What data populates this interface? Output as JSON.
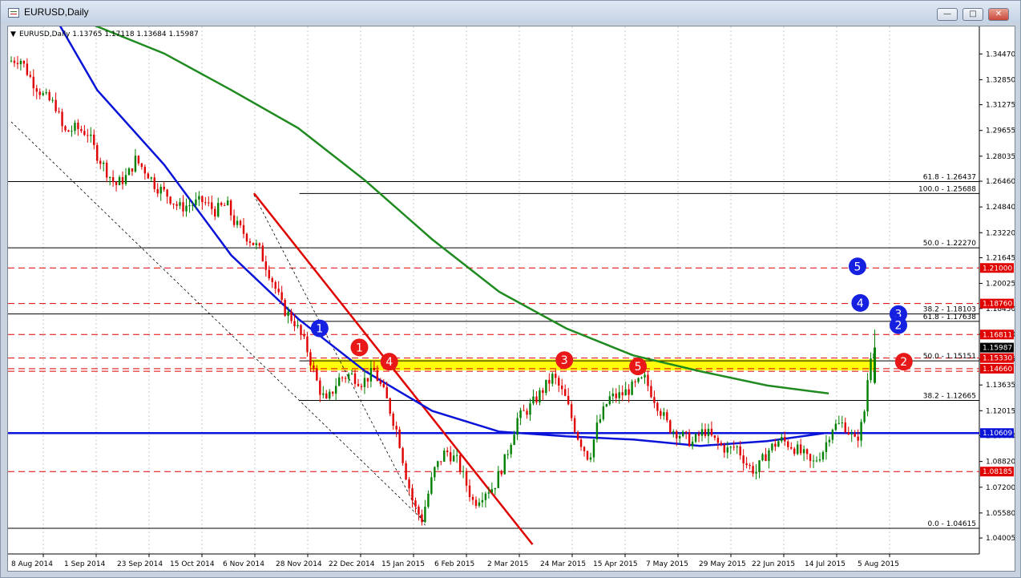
{
  "window": {
    "title": "EURUSD,Daily",
    "buttons": [
      {
        "name": "minimize",
        "label": "—"
      },
      {
        "name": "restore",
        "label": "□"
      },
      {
        "name": "close",
        "label": "✕"
      }
    ]
  },
  "header": {
    "info": "EURUSD,Daily  1.13765 1.17118 1.13684 1.15987"
  },
  "colors": {
    "bull": "#008000",
    "bear": "#e00000",
    "ma_blue": "#0a14d8",
    "ma_green": "#1f8a1f",
    "trend_red": "#e00000",
    "zone": "#ffff00",
    "marker_red": "#e81818",
    "marker_blue": "#1520e0"
  },
  "chart_data": {
    "type": "candlestick",
    "symbol": "EURUSD",
    "timeframe": "Daily",
    "ylim": [
      1.03,
      1.362
    ],
    "y_ticks": [
      "1.34470",
      "1.32850",
      "1.31275",
      "1.29655",
      "1.28035",
      "1.26460",
      "1.24840",
      "1.23220",
      "1.21645",
      "1.20025",
      "1.18450",
      "1.16830",
      "1.15255",
      "1.13635",
      "1.12015",
      "1.10440",
      "1.08820",
      "1.07200",
      "1.05580",
      "1.04005"
    ],
    "x_labels": [
      "8 Aug 2014",
      "1 Sep 2014",
      "23 Sep 2014",
      "15 Oct 2014",
      "6 Nov 2014",
      "28 Nov 2014",
      "22 Dec 2014",
      "15 Jan 2015",
      "6 Feb 2015",
      "2 Mar 2015",
      "24 Mar 2015",
      "15 Apr 2015",
      "7 May 2015",
      "29 May 2015",
      "22 Jun 2015",
      "14 Jul 2015",
      "5 Aug 2015"
    ],
    "bar_count": 270,
    "price_path": [
      [
        0,
        1.34
      ],
      [
        6,
        1.342
      ],
      [
        12,
        1.328
      ],
      [
        18,
        1.318
      ],
      [
        24,
        1.312
      ],
      [
        28,
        1.295
      ],
      [
        34,
        1.298
      ],
      [
        40,
        1.295
      ],
      [
        44,
        1.283
      ],
      [
        50,
        1.27
      ],
      [
        54,
        1.262
      ],
      [
        60,
        1.268
      ],
      [
        64,
        1.278
      ],
      [
        70,
        1.27
      ],
      [
        74,
        1.262
      ],
      [
        80,
        1.256
      ],
      [
        86,
        1.248
      ],
      [
        92,
        1.25
      ],
      [
        98,
        1.252
      ],
      [
        104,
        1.246
      ],
      [
        110,
        1.25
      ],
      [
        114,
        1.238
      ],
      [
        120,
        1.23
      ],
      [
        126,
        1.222
      ],
      [
        132,
        1.205
      ],
      [
        138,
        1.185
      ],
      [
        144,
        1.176
      ],
      [
        150,
        1.16
      ],
      [
        156,
        1.135
      ],
      [
        160,
        1.125
      ],
      [
        166,
        1.14
      ],
      [
        172,
        1.143
      ],
      [
        178,
        1.138
      ],
      [
        184,
        1.145
      ],
      [
        190,
        1.128
      ],
      [
        196,
        1.105
      ],
      [
        200,
        1.08
      ],
      [
        204,
        1.06
      ],
      [
        208,
        1.052
      ],
      [
        214,
        1.082
      ],
      [
        220,
        1.095
      ],
      [
        226,
        1.088
      ],
      [
        230,
        1.075
      ],
      [
        234,
        1.062
      ],
      [
        240,
        1.07
      ],
      [
        244,
        1.072
      ],
      [
        250,
        1.09
      ],
      [
        256,
        1.115
      ],
      [
        262,
        1.122
      ],
      [
        268,
        1.132
      ],
      [
        274,
        1.142
      ],
      [
        280,
        1.128
      ],
      [
        286,
        1.105
      ],
      [
        292,
        1.09
      ],
      [
        296,
        1.11
      ],
      [
        302,
        1.128
      ],
      [
        308,
        1.13
      ],
      [
        314,
        1.135
      ],
      [
        320,
        1.14
      ],
      [
        326,
        1.125
      ],
      [
        332,
        1.11
      ],
      [
        338,
        1.105
      ],
      [
        344,
        1.1
      ],
      [
        350,
        1.108
      ],
      [
        356,
        1.1
      ],
      [
        362,
        1.095
      ],
      [
        366,
        1.098
      ],
      [
        372,
        1.085
      ],
      [
        376,
        1.082
      ],
      [
        382,
        1.095
      ],
      [
        388,
        1.102
      ],
      [
        394,
        1.098
      ],
      [
        400,
        1.092
      ],
      [
        404,
        1.086
      ],
      [
        410,
        1.096
      ],
      [
        414,
        1.11
      ],
      [
        420,
        1.112
      ],
      [
        426,
        1.1
      ],
      [
        430,
        1.115
      ],
      [
        432,
        1.14
      ],
      [
        434,
        1.16
      ]
    ],
    "moving_averages": [
      {
        "color": "ma_blue",
        "points": [
          [
            0,
            1.445
          ],
          [
            60,
            1.395
          ],
          [
            120,
            1.322
          ],
          [
            180,
            1.275
          ],
          [
            240,
            1.218
          ],
          [
            300,
            1.178
          ],
          [
            360,
            1.145
          ],
          [
            420,
            1.12
          ],
          [
            480,
            1.107
          ],
          [
            540,
            1.104
          ],
          [
            600,
            1.102
          ],
          [
            660,
            1.098
          ],
          [
            720,
            1.101
          ],
          [
            771,
            1.106
          ]
        ]
      },
      {
        "color": "ma_green",
        "points": [
          [
            0,
            1.4
          ],
          [
            60,
            1.378
          ],
          [
            120,
            1.362
          ],
          [
            180,
            1.345
          ],
          [
            240,
            1.322
          ],
          [
            300,
            1.298
          ],
          [
            360,
            1.265
          ],
          [
            420,
            1.228
          ],
          [
            480,
            1.195
          ],
          [
            540,
            1.172
          ],
          [
            600,
            1.155
          ],
          [
            660,
            1.145
          ],
          [
            720,
            1.136
          ],
          [
            775,
            1.131
          ]
        ]
      }
    ],
    "levels": [
      {
        "label": "61.8 - 1.26437",
        "price": 1.26437,
        "style": "solid",
        "color": "#000000",
        "x_start": 0
      },
      {
        "label": "100.0 - 1.25688",
        "price": 1.25688,
        "style": "solid",
        "color": "#000000",
        "x_start": 0.3
      },
      {
        "label": "50.0 - 1.22270",
        "price": 1.2227,
        "style": "solid",
        "color": "#000000",
        "x_start": 0
      },
      {
        "label": "38.2 - 1.18103",
        "price": 1.18103,
        "style": "solid",
        "color": "#000000",
        "x_start": 0
      },
      {
        "label": "61.8 - 1.17638",
        "price": 1.17638,
        "style": "solid",
        "color": "#000000",
        "x_start": 0.3
      },
      {
        "label": "50.0 - 1.15151",
        "price": 1.15151,
        "style": "solid",
        "color": "#000000",
        "x_start": 0.3
      },
      {
        "label": "38.2 - 1.12665",
        "price": 1.12665,
        "style": "solid",
        "color": "#000000",
        "x_start": 0.3
      },
      {
        "label": "0.0 - 1.04615",
        "price": 1.04615,
        "style": "solid",
        "color": "#000000",
        "x_start": 0
      }
    ],
    "horizontal_lines": [
      {
        "price": 1.21,
        "label": "1.21000",
        "color": "#e00000",
        "style": "dash",
        "box": true
      },
      {
        "price": 1.1876,
        "label": "1.18760",
        "color": "#e00000",
        "style": "dash",
        "box": true
      },
      {
        "price": 1.16811,
        "label": "1.16811",
        "color": "#e00000",
        "style": "dash",
        "box": true
      },
      {
        "price": 1.1533,
        "label": "1.15330",
        "color": "#e00000",
        "style": "dash",
        "box": true
      },
      {
        "price": 1.1466,
        "label": "1.14660",
        "color": "#e00000",
        "style": "dash",
        "box": true
      },
      {
        "price": 1.145,
        "label": "",
        "color": "#e00000",
        "style": "dash",
        "box": false
      },
      {
        "price": 1.10609,
        "label": "1.10609",
        "color": "#0a14d8",
        "style": "solid",
        "box": true
      },
      {
        "price": 1.08185,
        "label": "1.08185",
        "color": "#e00000",
        "style": "dash",
        "box": true
      }
    ],
    "current_price": {
      "price": 1.15987,
      "label": "1.15987"
    },
    "zone": {
      "top": 1.15251,
      "bottom": 1.1456
    },
    "markers": [
      {
        "label": "1",
        "color": "marker_blue",
        "bar": 155,
        "price": 1.172
      },
      {
        "label": "1",
        "color": "marker_red",
        "bar": 175,
        "price": 1.16
      },
      {
        "label": "4",
        "color": "marker_red",
        "bar": 190,
        "price": 1.151
      },
      {
        "label": "3",
        "color": "marker_red",
        "bar": 278,
        "price": 1.152
      },
      {
        "label": "5",
        "color": "marker_red",
        "bar": 315,
        "price": 1.148
      },
      {
        "label": "2",
        "color": "marker_red",
        "bar": 392,
        "price": 1.151
      },
      {
        "label": "5",
        "color": "marker_blue",
        "bar": 375,
        "price": 1.211
      },
      {
        "label": "4",
        "color": "marker_blue",
        "bar": 376,
        "price": 1.188
      },
      {
        "label": "3",
        "color": "marker_blue",
        "bar": 390,
        "price": 1.181
      },
      {
        "label": "2",
        "color": "marker_blue",
        "bar": 390,
        "price": 1.174
      }
    ]
  }
}
